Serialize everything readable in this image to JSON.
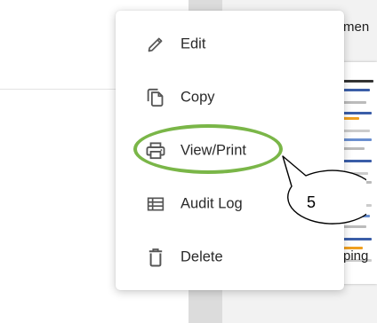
{
  "background": {
    "doc_header_text": "men",
    "doc_footer_text": "ping",
    "doc_thumb_colors": [
      "#3b5ea8",
      "#f0a020",
      "#6a8fd0",
      "#999999"
    ]
  },
  "menu": {
    "items": [
      {
        "label": "Edit",
        "icon": "pencil-icon"
      },
      {
        "label": "Copy",
        "icon": "copy-icon"
      },
      {
        "label": "View/Print",
        "icon": "printer-icon"
      },
      {
        "label": "Audit Log",
        "icon": "list-icon"
      },
      {
        "label": "Delete",
        "icon": "trash-icon"
      }
    ]
  },
  "annotation": {
    "callout_number": "5",
    "highlight_color": "#7ab648"
  }
}
